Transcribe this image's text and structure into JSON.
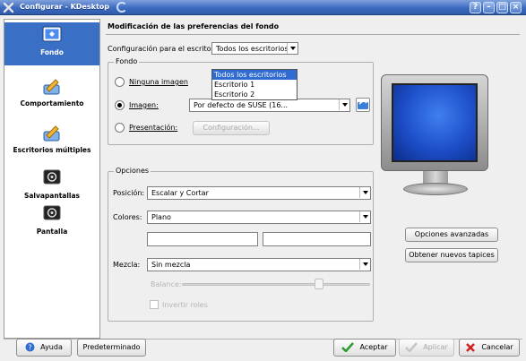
{
  "titlebar": {
    "title": "Configurar - KDesktop",
    "help_label": "?",
    "min_label": "–",
    "max_label": "□",
    "close_label": "×"
  },
  "sidebar": {
    "items": [
      {
        "label": "Fondo",
        "icon": "monitor-icon",
        "active": true
      },
      {
        "label": "Comportamiento",
        "icon": "desktop-tools-icon"
      },
      {
        "label": "Escritorios múltiples",
        "icon": "multiple-desktops-icon"
      },
      {
        "label": "Salvapantallas",
        "icon": "screensaver-icon"
      },
      {
        "label": "Pantalla",
        "icon": "display-icon"
      }
    ]
  },
  "page": {
    "title": "Modificación de las preferencias del fondo",
    "desktop_label": "Configuración para el escritorio:",
    "desktop_value": "Todos los escritorios",
    "desktop_options": [
      "Todos los escritorios",
      "Escritorio 1",
      "Escritorio 2"
    ]
  },
  "fondo": {
    "group_title": "Fondo",
    "no_image_label": "Ninguna imagen",
    "image_label": "Imagen:",
    "image_value": "Por defecto de SUSE (16...",
    "slideshow_label": "Presentación:",
    "config_button": "Configuración..."
  },
  "opciones": {
    "group_title": "Opciones",
    "position_label": "Posición:",
    "position_value": "Escalar y Cortar",
    "colors_label": "Colores:",
    "colors_value": "Plano",
    "blend_label": "Mezcla:",
    "blend_value": "Sin mezcla",
    "balance_label": "Balance:",
    "invert_label": "Invertir roles"
  },
  "side_buttons": {
    "advanced": "Opciones avanzadas",
    "get_new": "Obtener nuevos tapices"
  },
  "footer": {
    "help": "Ayuda",
    "defaults": "Predeterminado",
    "accept": "Aceptar",
    "apply": "Aplicar",
    "cancel": "Cancelar"
  },
  "colors": {
    "accent": "#3a6fc6",
    "titlebar": "#3d6bc1",
    "accept_check": "#2c9a2c",
    "cancel_x": "#d02020"
  }
}
